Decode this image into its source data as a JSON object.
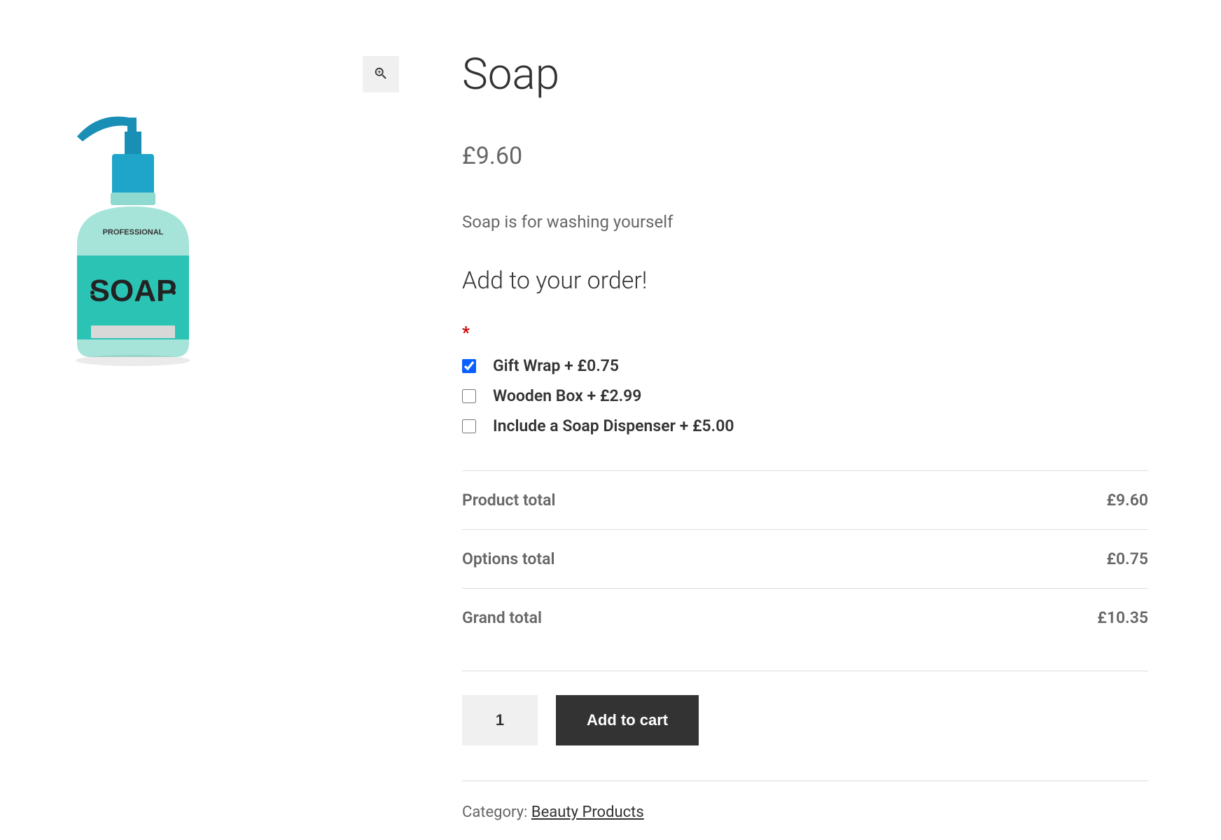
{
  "product": {
    "title": "Soap",
    "price": "£9.60",
    "description": "Soap is for washing yourself",
    "imageLabel": "SOAP"
  },
  "addons": {
    "heading": "Add to your order!",
    "required_indicator": "*",
    "options": [
      {
        "label": "Gift Wrap + £0.75",
        "checked": true
      },
      {
        "label": "Wooden Box + £2.99",
        "checked": false
      },
      {
        "label": "Include a Soap Dispenser + £5.00",
        "checked": false
      }
    ]
  },
  "totals": {
    "product_total_label": "Product total",
    "product_total_value": "£9.60",
    "options_total_label": "Options total",
    "options_total_value": "£0.75",
    "grand_total_label": "Grand total",
    "grand_total_value": "£10.35"
  },
  "cart": {
    "quantity": "1",
    "add_button_label": "Add to cart"
  },
  "meta": {
    "category_label": "Category: ",
    "category_link": "Beauty Products"
  }
}
